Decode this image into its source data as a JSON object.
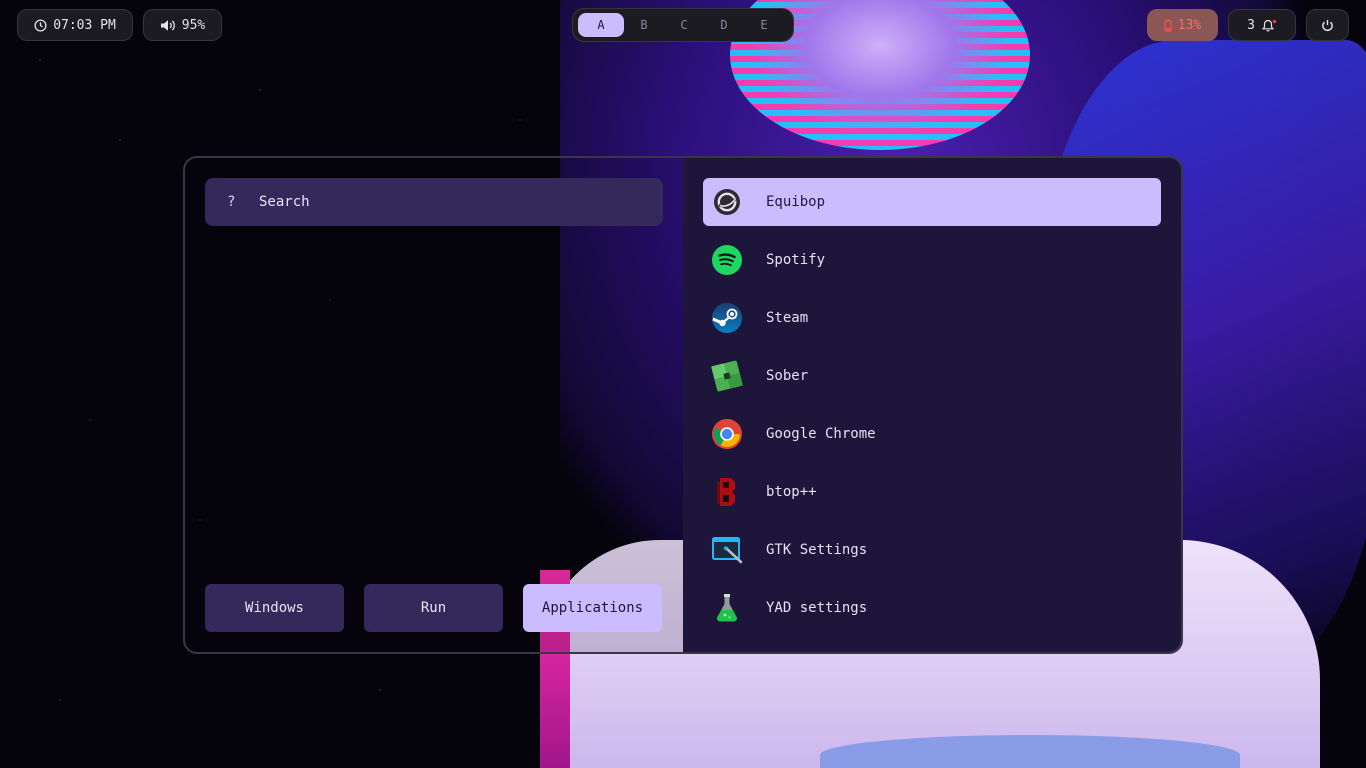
{
  "topbar": {
    "clock": {
      "time": "07:03 PM",
      "icon": "clock-icon"
    },
    "volume": {
      "level": "95%",
      "icon": "speaker-icon"
    },
    "workspaces": [
      {
        "label": "A",
        "active": true
      },
      {
        "label": "B",
        "active": false
      },
      {
        "label": "C",
        "active": false
      },
      {
        "label": "D",
        "active": false
      },
      {
        "label": "E",
        "active": false
      }
    ],
    "battery": {
      "level": "13%",
      "icon": "battery-low-icon",
      "color": "#ff5a5a"
    },
    "notifications": {
      "count": "3",
      "icon": "bell-icon"
    },
    "power": {
      "icon": "power-icon"
    }
  },
  "launcher": {
    "search": {
      "prefix": "?",
      "placeholder": "Search"
    },
    "modes": [
      {
        "label": "Windows",
        "active": false
      },
      {
        "label": "Run",
        "active": false
      },
      {
        "label": "Applications",
        "active": true
      }
    ],
    "apps": [
      {
        "label": "Equibop",
        "icon": "equibop-icon",
        "selected": true
      },
      {
        "label": "Spotify",
        "icon": "spotify-icon",
        "selected": false
      },
      {
        "label": "Steam",
        "icon": "steam-icon",
        "selected": false
      },
      {
        "label": "Sober",
        "icon": "sober-icon",
        "selected": false
      },
      {
        "label": "Google Chrome",
        "icon": "chrome-icon",
        "selected": false
      },
      {
        "label": "btop++",
        "icon": "btop-icon",
        "selected": false
      },
      {
        "label": "GTK Settings",
        "icon": "gtk-settings-icon",
        "selected": false
      },
      {
        "label": "YAD settings",
        "icon": "yad-flask-icon",
        "selected": false
      }
    ],
    "accent": "#cbbcff"
  }
}
